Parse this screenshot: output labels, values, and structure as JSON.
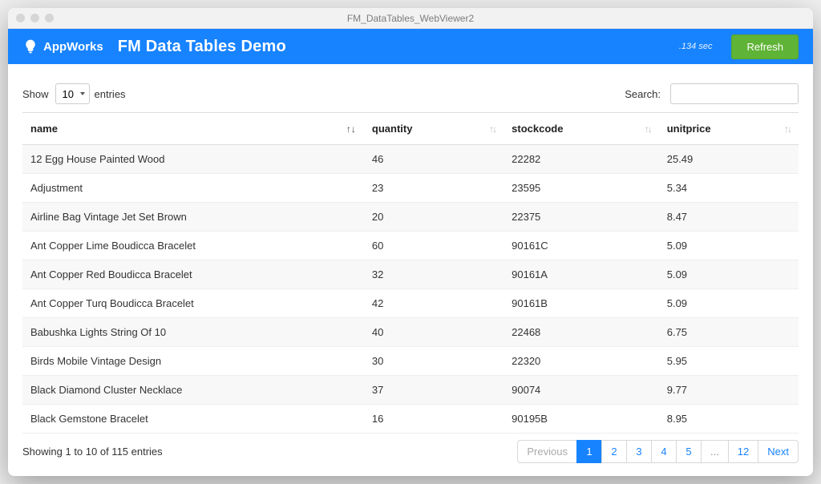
{
  "window": {
    "title": "FM_DataTables_WebViewer2"
  },
  "header": {
    "brand": "AppWorks",
    "title": "FM Data Tables Demo",
    "timing": ".134 sec",
    "refresh_label": "Refresh"
  },
  "length": {
    "show_label": "Show",
    "entries_label": "entries",
    "selected": "10"
  },
  "search": {
    "label": "Search:",
    "value": ""
  },
  "columns": [
    {
      "key": "name",
      "label": "name",
      "sort": "asc"
    },
    {
      "key": "quantity",
      "label": "quantity",
      "sort": "none"
    },
    {
      "key": "stockcode",
      "label": "stockcode",
      "sort": "none"
    },
    {
      "key": "unitprice",
      "label": "unitprice",
      "sort": "none"
    }
  ],
  "rows": [
    {
      "name": "12 Egg House Painted Wood",
      "quantity": "46",
      "stockcode": "22282",
      "unitprice": "25.49"
    },
    {
      "name": "Adjustment",
      "quantity": "23",
      "stockcode": "23595",
      "unitprice": "5.34"
    },
    {
      "name": "Airline Bag Vintage Jet Set Brown",
      "quantity": "20",
      "stockcode": "22375",
      "unitprice": "8.47"
    },
    {
      "name": "Ant Copper Lime Boudicca Bracelet",
      "quantity": "60",
      "stockcode": "90161C",
      "unitprice": "5.09"
    },
    {
      "name": "Ant Copper Red Boudicca Bracelet",
      "quantity": "32",
      "stockcode": "90161A",
      "unitprice": "5.09"
    },
    {
      "name": "Ant Copper Turq Boudicca Bracelet",
      "quantity": "42",
      "stockcode": "90161B",
      "unitprice": "5.09"
    },
    {
      "name": "Babushka Lights String Of 10",
      "quantity": "40",
      "stockcode": "22468",
      "unitprice": "6.75"
    },
    {
      "name": "Birds Mobile Vintage Design",
      "quantity": "30",
      "stockcode": "22320",
      "unitprice": "5.95"
    },
    {
      "name": "Black Diamond Cluster Necklace",
      "quantity": "37",
      "stockcode": "90074",
      "unitprice": "9.77"
    },
    {
      "name": "Black Gemstone Bracelet",
      "quantity": "16",
      "stockcode": "90195B",
      "unitprice": "8.95"
    }
  ],
  "info": "Showing 1 to 10 of 115 entries",
  "pagination": {
    "prev_label": "Previous",
    "next_label": "Next",
    "pages": [
      "1",
      "2",
      "3",
      "4",
      "5"
    ],
    "ellipsis": "...",
    "last": "12",
    "active": "1"
  }
}
